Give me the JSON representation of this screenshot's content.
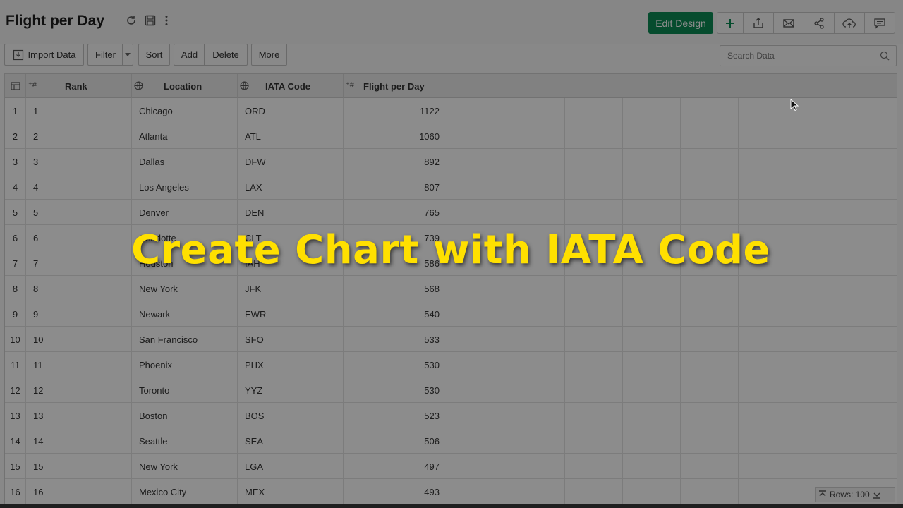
{
  "header": {
    "title": "Flight per Day",
    "edit_design_label": "Edit Design",
    "accent_color": "#0b8a55"
  },
  "toolbar": {
    "import_label": "Import Data",
    "filter_label": "Filter",
    "sort_label": "Sort",
    "add_label": "Add",
    "delete_label": "Delete",
    "more_label": "More",
    "search_placeholder": "Search Data"
  },
  "table": {
    "columns": {
      "rank": "Rank",
      "location": "Location",
      "iata": "IATA Code",
      "flights": "Flight per Day"
    },
    "rows": [
      {
        "idx": "1",
        "rank": "1",
        "location": "Chicago",
        "iata": "ORD",
        "flights": "1122"
      },
      {
        "idx": "2",
        "rank": "2",
        "location": "Atlanta",
        "iata": "ATL",
        "flights": "1060"
      },
      {
        "idx": "3",
        "rank": "3",
        "location": "Dallas",
        "iata": "DFW",
        "flights": "892"
      },
      {
        "idx": "4",
        "rank": "4",
        "location": "Los Angeles",
        "iata": "LAX",
        "flights": "807"
      },
      {
        "idx": "5",
        "rank": "5",
        "location": "Denver",
        "iata": "DEN",
        "flights": "765"
      },
      {
        "idx": "6",
        "rank": "6",
        "location": "Charlotte",
        "iata": "CLT",
        "flights": "739"
      },
      {
        "idx": "7",
        "rank": "7",
        "location": "Houston",
        "iata": "IAH",
        "flights": "586"
      },
      {
        "idx": "8",
        "rank": "8",
        "location": "New York",
        "iata": "JFK",
        "flights": "568"
      },
      {
        "idx": "9",
        "rank": "9",
        "location": "Newark",
        "iata": "EWR",
        "flights": "540"
      },
      {
        "idx": "10",
        "rank": "10",
        "location": "San Francisco",
        "iata": "SFO",
        "flights": "533"
      },
      {
        "idx": "11",
        "rank": "11",
        "location": "Phoenix",
        "iata": "PHX",
        "flights": "530"
      },
      {
        "idx": "12",
        "rank": "12",
        "location": "Toronto",
        "iata": "YYZ",
        "flights": "530"
      },
      {
        "idx": "13",
        "rank": "13",
        "location": "Boston",
        "iata": "BOS",
        "flights": "523"
      },
      {
        "idx": "14",
        "rank": "14",
        "location": "Seattle",
        "iata": "SEA",
        "flights": "506"
      },
      {
        "idx": "15",
        "rank": "15",
        "location": "New York",
        "iata": "LGA",
        "flights": "497"
      },
      {
        "idx": "16",
        "rank": "16",
        "location": "Mexico City",
        "iata": "MEX",
        "flights": "493"
      }
    ]
  },
  "footer": {
    "rows_label": "Rows: 100"
  },
  "overlay": {
    "caption": "Create Chart with IATA Code",
    "caption_color": "#ffe000"
  }
}
